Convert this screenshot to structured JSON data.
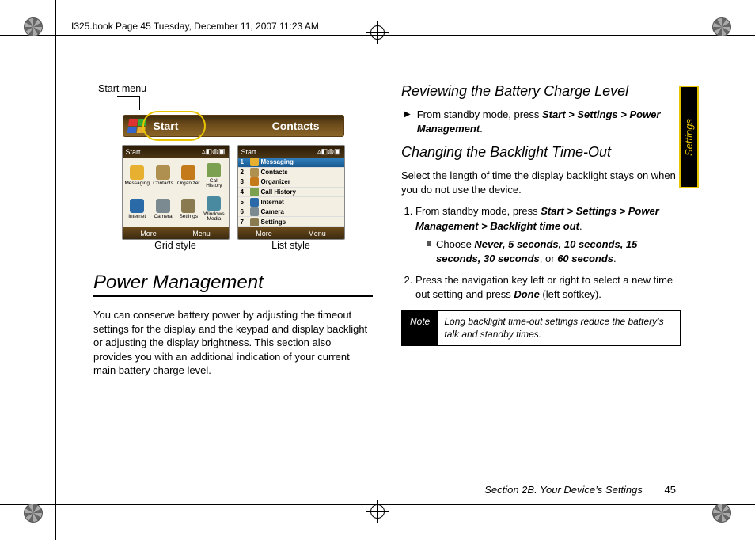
{
  "header_text": "I325.book  Page 45  Tuesday, December 11, 2007  11:23 AM",
  "side_tab": "Settings",
  "left": {
    "start_menu_label": "Start menu",
    "softkey_start": "Start",
    "softkey_contacts": "Contacts",
    "shot_titlebar": "Start",
    "shot_more": "More",
    "shot_menu": "Menu",
    "grid_apps": [
      "Messaging",
      "Contacts",
      "Organizer",
      "Call History",
      "Internet",
      "Camera",
      "Settings",
      "Windows Media"
    ],
    "list_apps": [
      "Messaging",
      "Contacts",
      "Organizer",
      "Call History",
      "Internet",
      "Camera",
      "Settings"
    ],
    "caption_grid": "Grid style",
    "caption_list": "List style",
    "h1": "Power Management",
    "para": "You can conserve battery power by adjusting the timeout settings for the display and the keypad and display backlight or adjusting the display brightness. This section also provides you with an additional indication of your current main battery charge level."
  },
  "right": {
    "h2a": "Reviewing the Battery Charge Level",
    "bullet_a_pre": "From standby mode, press ",
    "bullet_a_bold": "Start > Settings > Power Management",
    "bullet_a_post": ".",
    "h2b": "Changing the Backlight Time-Out",
    "para_b": "Select the length of time the display backlight stays on when you do not use the device.",
    "step1_pre": "From standby mode, press ",
    "step1_bold": "Start > Settings > Power Management > Backlight time out",
    "step1_post": ".",
    "step1_sub_pre": "Choose ",
    "step1_sub_opts": "Never, 5 seconds, 10 seconds, 15 seconds, 30 seconds",
    "step1_sub_or": ", or ",
    "step1_sub_last": "60 seconds",
    "step1_sub_post": ".",
    "step2_pre": "Press the navigation key left or right to select a new time out setting and press ",
    "step2_bold": "Done",
    "step2_post": " (left softkey).",
    "note_label": "Note",
    "note_body": "Long backlight time-out settings reduce the battery’s talk and standby times."
  },
  "footer_section": "Section 2B. Your Device’s Settings",
  "footer_page": "45"
}
